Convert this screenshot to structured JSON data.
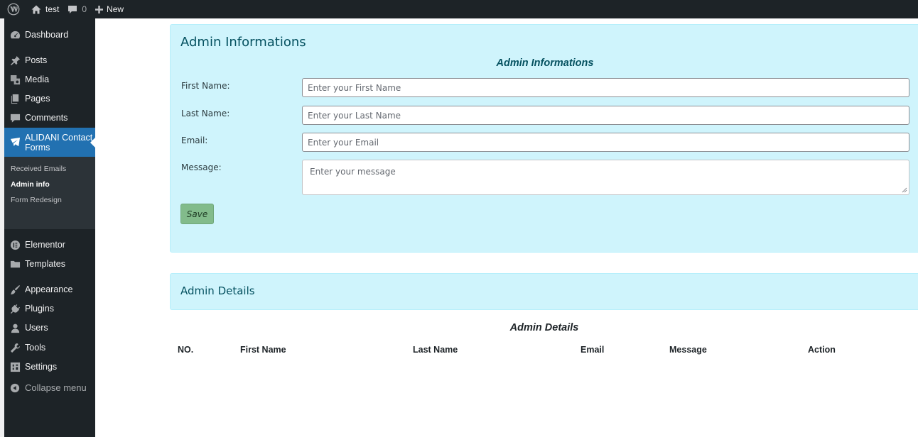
{
  "admin_bar": {
    "site_name": "test",
    "comments_count": "0",
    "new_label": "New"
  },
  "sidebar": {
    "items": [
      {
        "label": "Dashboard",
        "icon": "dashboard-icon"
      },
      {
        "label": "Posts",
        "icon": "pin-icon"
      },
      {
        "label": "Media",
        "icon": "media-icon"
      },
      {
        "label": "Pages",
        "icon": "pages-icon"
      },
      {
        "label": "Comments",
        "icon": "comment-icon"
      },
      {
        "label": "ALIDANI Contact Forms",
        "label_line1": "ALIDANI Contact",
        "label_line2": "Forms",
        "icon": "envelope-check-icon",
        "current": true
      },
      {
        "label": "Elementor",
        "icon": "elementor-icon"
      },
      {
        "label": "Templates",
        "icon": "folder-icon"
      },
      {
        "label": "Appearance",
        "icon": "brush-icon"
      },
      {
        "label": "Plugins",
        "icon": "plug-icon"
      },
      {
        "label": "Users",
        "icon": "user-icon"
      },
      {
        "label": "Tools",
        "icon": "wrench-icon"
      },
      {
        "label": "Settings",
        "icon": "settings-icon"
      }
    ],
    "submenu": [
      {
        "label": "Received Emails"
      },
      {
        "label": "Admin info",
        "current": true
      },
      {
        "label": "Form Redesign"
      }
    ],
    "collapse_label": "Collapse menu"
  },
  "info_panel": {
    "title": "Admin Informations",
    "form_heading": "Admin Informations",
    "fields": [
      {
        "label": "First Name:",
        "placeholder": "Enter your First Name"
      },
      {
        "label": "Last Name:",
        "placeholder": "Enter your Last Name"
      },
      {
        "label": "Email:",
        "placeholder": "Enter your Email"
      },
      {
        "label": "Message:",
        "placeholder": "Enter your message"
      }
    ],
    "save_label": "Save"
  },
  "details_panel": {
    "title": "Admin Details",
    "table_caption": "Admin Details",
    "columns": [
      "NO.",
      "First Name",
      "Last Name",
      "Email",
      "Message",
      "Action"
    ]
  },
  "colors": {
    "admin_bar": "#1d2327",
    "sidebar": "#1d2327",
    "current_menu": "#2271b1",
    "panel_bg": "#cff4fc",
    "panel_text": "#055160",
    "save_button": "#82bb8b"
  }
}
